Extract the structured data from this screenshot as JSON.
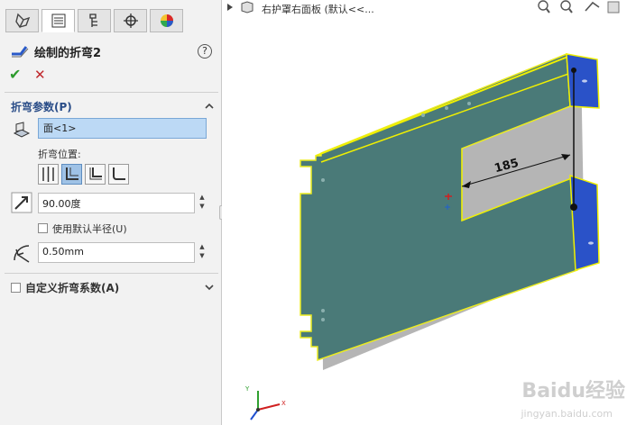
{
  "feature": {
    "title": "绘制的折弯2",
    "help_label": "?"
  },
  "actions": {
    "ok_symbol": "✔",
    "cancel_symbol": "✕"
  },
  "section": {
    "title": "折弯参数(P)",
    "face_value": "面<1>",
    "bend_position_label": "折弯位置:",
    "angle_value": "90.00度",
    "use_default_radius_label": "使用默认半径(U)",
    "radius_value": "0.50mm",
    "custom_factor_label": "自定义折弯系数(A)"
  },
  "viewport": {
    "breadcrumb": "右护罩右面板  (默认<<...",
    "dimension": "185",
    "axis_x": "X",
    "axis_y": "Y",
    "watermark": "Baidu经验",
    "watermark_sub": "jingyan.baidu.com"
  },
  "colors": {
    "part_face": "#4a7a78",
    "edge": "#f0f000",
    "flange": "#2a52c8",
    "section_title": "#2a4d88"
  }
}
